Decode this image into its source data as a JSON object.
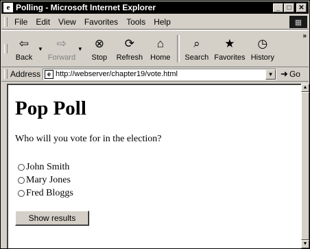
{
  "window": {
    "title": "Polling - Microsoft Internet Explorer",
    "minimize": "_",
    "maximize": "□",
    "close": "✕"
  },
  "menu": {
    "items": [
      "File",
      "Edit",
      "View",
      "Favorites",
      "Tools",
      "Help"
    ]
  },
  "toolbar": {
    "back": "Back",
    "forward": "Forward",
    "stop": "Stop",
    "refresh": "Refresh",
    "home": "Home",
    "search": "Search",
    "favorites": "Favorites",
    "history": "History",
    "more": "»"
  },
  "address": {
    "label": "Address",
    "url": "http://webserver/chapter19/vote.html",
    "go": "Go"
  },
  "page": {
    "title": "Pop Poll",
    "question": "Who will you vote for in the election?",
    "options": [
      "John Smith",
      "Mary Jones",
      "Fred Bloggs"
    ],
    "submit": "Show results"
  },
  "icons": {
    "back": "arrow-left-icon",
    "forward": "arrow-right-icon",
    "stop": "stop-icon",
    "refresh": "refresh-icon",
    "home": "home-icon",
    "search": "search-icon",
    "favorites": "favorites-icon",
    "history": "history-icon"
  }
}
